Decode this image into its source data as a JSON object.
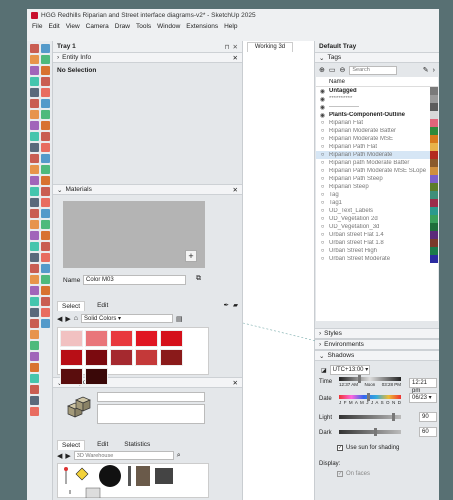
{
  "window": {
    "title": "HGG Redhills Riparian and Street interface diagrams-v2* - SketchUp 2025"
  },
  "menu": [
    "File",
    "Edit",
    "View",
    "Camera",
    "Draw",
    "Tools",
    "Window",
    "Extensions",
    "Help"
  ],
  "tray1": {
    "title": "Tray 1",
    "entity_info": {
      "header": "Entity Info",
      "text": "No Selection"
    },
    "materials": {
      "header": "Materials",
      "name_label": "Name",
      "name_value": "Color M03",
      "tabs": [
        "Select",
        "Edit"
      ],
      "library": "Solid Colors"
    },
    "components": {
      "header": "Components",
      "tabs": [
        "Select",
        "Edit",
        "Statistics"
      ],
      "search_placeholder": "3D Warehouse"
    }
  },
  "scene_tab": "Working 3d",
  "default_tray": {
    "title": "Default Tray",
    "tags": {
      "header": "Tags",
      "search_placeholder": "Search",
      "column_name": "Name",
      "rows": [
        {
          "name": "Untagged",
          "bold": true,
          "color": "#7a7a7a",
          "eye": "visible"
        },
        {
          "name": "**********",
          "bold": false,
          "color": "#9a9a9a",
          "eye": "visible"
        },
        {
          "name": "—————",
          "bold": false,
          "color": "#5c5c5c",
          "eye": "visible"
        },
        {
          "name": "Plants-Component-Outline",
          "bold": true,
          "color": "#d8d8d8",
          "eye": "visible"
        },
        {
          "name": "Riparian Flat",
          "bold": false,
          "color": "#e2657a",
          "eye": "hidden"
        },
        {
          "name": "Riparian Moderate Batter",
          "bold": false,
          "color": "#2f8a3b",
          "eye": "hidden"
        },
        {
          "name": "Riparian Moderate MSE",
          "bold": false,
          "color": "#d87a1d",
          "eye": "hidden"
        },
        {
          "name": "Riparian Path Flat",
          "bold": false,
          "color": "#e8b34a",
          "eye": "hidden"
        },
        {
          "name": "Riparian Path Moderate",
          "bold": false,
          "color": "#b32b1f",
          "eye": "hidden",
          "selected": true
        },
        {
          "name": "Riparian path Moderate Batter",
          "bold": false,
          "color": "#8a5a2b",
          "eye": "hidden"
        },
        {
          "name": "Riparian Path Moderate MSE SLope",
          "bold": false,
          "color": "#cf8f3d",
          "eye": "hidden"
        },
        {
          "name": "Riparian Path Steep",
          "bold": false,
          "color": "#7b5fc9",
          "eye": "hidden"
        },
        {
          "name": "Riparian Steep",
          "bold": false,
          "color": "#5c7c2b",
          "eye": "hidden"
        },
        {
          "name": "Tag",
          "bold": false,
          "color": "#3e8f7a",
          "eye": "hidden"
        },
        {
          "name": "Tag1",
          "bold": false,
          "color": "#9b2d4a",
          "eye": "hidden"
        },
        {
          "name": "UD_Text_Labels",
          "bold": false,
          "color": "#2a9a8c",
          "eye": "hidden"
        },
        {
          "name": "UD_Vegetation 2d",
          "bold": false,
          "color": "#3aa05a",
          "eye": "hidden"
        },
        {
          "name": "UD_Vegetation_3d",
          "bold": false,
          "color": "#1f6e3a",
          "eye": "hidden"
        },
        {
          "name": "Urban street Flat 1.4",
          "bold": false,
          "color": "#5b2a7a",
          "eye": "hidden"
        },
        {
          "name": "Urban street Flat 1.8",
          "bold": false,
          "color": "#7a3a2a",
          "eye": "hidden"
        },
        {
          "name": "Urban Street High",
          "bold": false,
          "color": "#1a7a4a",
          "eye": "hidden"
        },
        {
          "name": "Urban Street Moderate",
          "bold": false,
          "color": "#2a2aa0",
          "eye": "hidden"
        }
      ]
    },
    "styles_header": "Styles",
    "environments_header": "Environments",
    "shadows": {
      "header": "Shadows",
      "timezone": "UTC+13:00",
      "time_label": "Time",
      "time_start": "12:37 AM",
      "time_noon": "Noon",
      "time_end": "03:28 PM",
      "time_value": "12:21 pm",
      "date_label": "Date",
      "months": "J F M A M J J A S O N D",
      "date_value": "06/23",
      "light_label": "Light",
      "light_value": "90",
      "dark_label": "Dark",
      "dark_value": "60",
      "sun_checkbox": "Use sun for shading",
      "display_label": "Display:",
      "on_faces": "On faces",
      "time_fraction": 0.33,
      "date_fraction": 0.48,
      "light_fraction": 0.9,
      "dark_fraction": 0.6
    }
  }
}
